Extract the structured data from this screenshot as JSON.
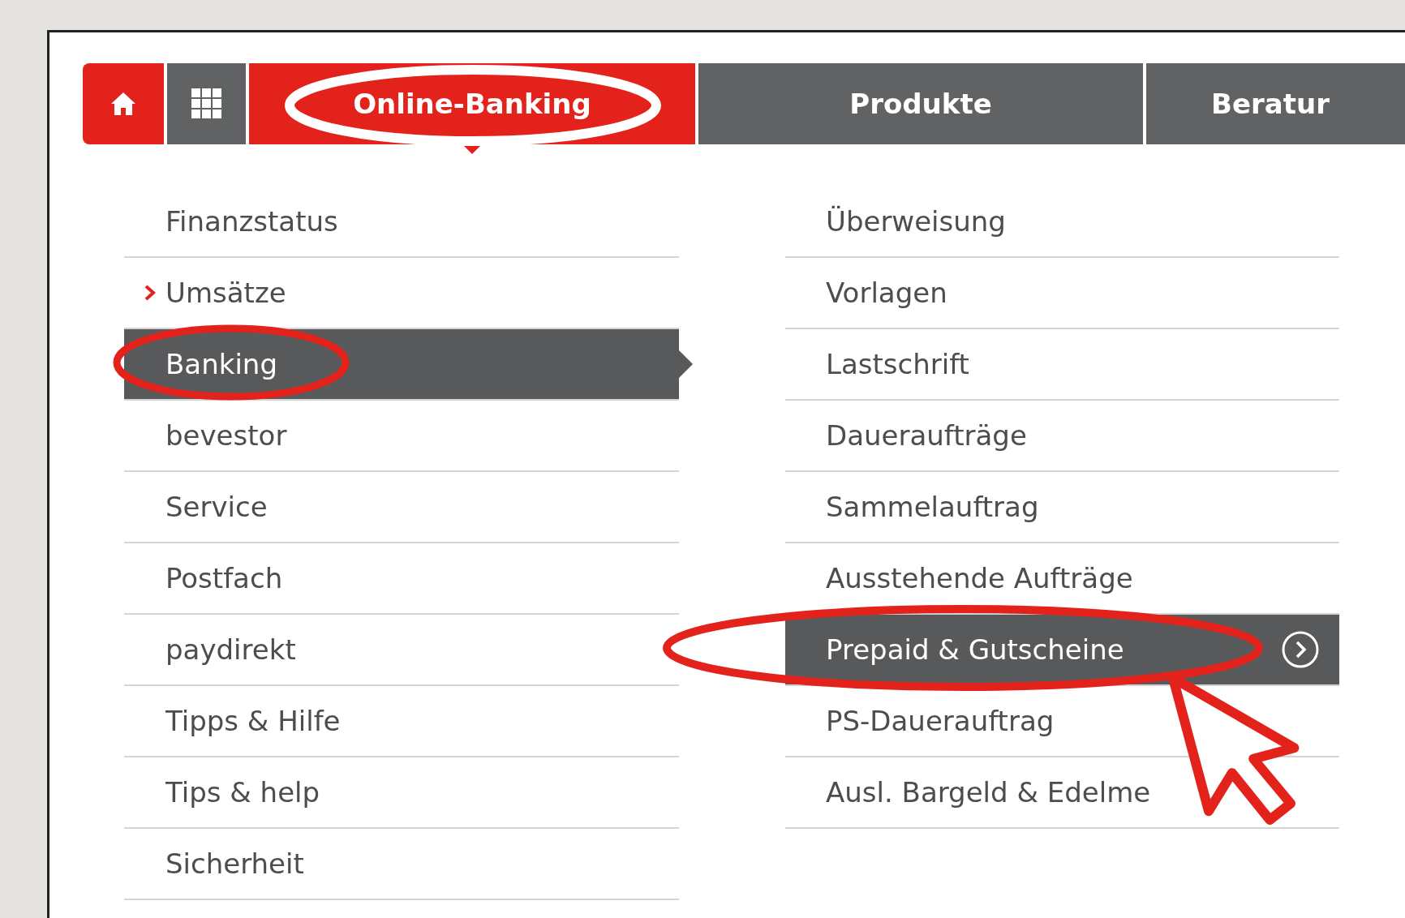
{
  "nav": {
    "tabs": [
      {
        "label": "Online-Banking",
        "selected": true
      },
      {
        "label": "Produkte",
        "selected": false
      },
      {
        "label": "Beratur",
        "selected": false
      }
    ]
  },
  "left_menu": [
    {
      "label": "Finanzstatus",
      "selected": false,
      "current": false
    },
    {
      "label": "Umsätze",
      "selected": false,
      "current": true
    },
    {
      "label": "Banking",
      "selected": true,
      "current": false
    },
    {
      "label": "bevestor",
      "selected": false,
      "current": false
    },
    {
      "label": "Service",
      "selected": false,
      "current": false
    },
    {
      "label": "Postfach",
      "selected": false,
      "current": false
    },
    {
      "label": "paydirekt",
      "selected": false,
      "current": false
    },
    {
      "label": "Tipps & Hilfe",
      "selected": false,
      "current": false
    },
    {
      "label": "Tips & help",
      "selected": false,
      "current": false
    },
    {
      "label": "Sicherheit",
      "selected": false,
      "current": false
    }
  ],
  "right_menu": [
    {
      "label": "Überweisung",
      "selected": false
    },
    {
      "label": "Vorlagen",
      "selected": false
    },
    {
      "label": "Lastschrift",
      "selected": false
    },
    {
      "label": "Daueraufträge",
      "selected": false
    },
    {
      "label": "Sammelauftrag",
      "selected": false
    },
    {
      "label": "Ausstehende Aufträge",
      "selected": false
    },
    {
      "label": "Prepaid & Gutscheine",
      "selected": true
    },
    {
      "label": "PS-Dauerauftrag",
      "selected": false
    },
    {
      "label": "Ausl. Bargeld & Edelme",
      "selected": false
    }
  ]
}
